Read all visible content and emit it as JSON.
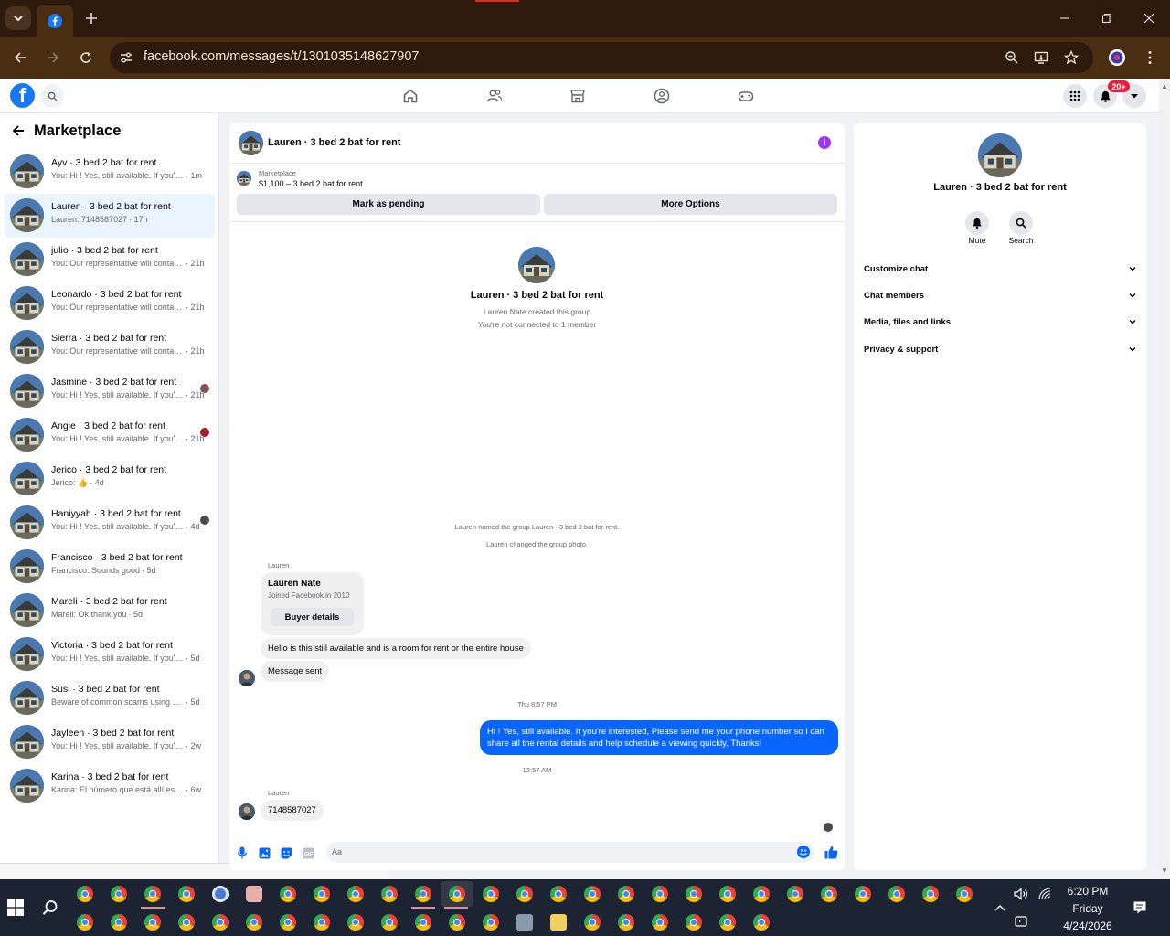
{
  "browser": {
    "url": "facebook.com/messages/t/1301035148627907"
  },
  "fb_nav": {
    "logo": "f",
    "notification_badge": "20+"
  },
  "left": {
    "title": "Marketplace",
    "conversations": [
      {
        "name": "Ayv · 3 bed 2 bat for rent",
        "preview": "You: Hi ! Yes, still available. If you're in...",
        "time": "· 1m"
      },
      {
        "name": "Lauren · 3 bed 2 bat for rent",
        "preview": "Lauren: 7148587027",
        "time": "· 17h"
      },
      {
        "name": "julio · 3 bed 2 bat for rent",
        "preview": "You: Our representative will contact ...",
        "time": "· 21h"
      },
      {
        "name": "Leonardo · 3 bed 2 bat for rent",
        "preview": "You: Our representative will contact ...",
        "time": "· 21h"
      },
      {
        "name": "Sierra · 3 bed 2 bat for rent",
        "preview": "You: Our representative will contact ...",
        "time": "· 21h"
      },
      {
        "name": "Jasmine · 3 bed 2 bat for rent",
        "preview": "You: Hi ! Yes, still available. If you'r...",
        "time": "· 21h"
      },
      {
        "name": "Angie · 3 bed 2 bat for rent",
        "preview": "You: Hi ! Yes, still available. If you'r...",
        "time": "· 21h"
      },
      {
        "name": "Jerico · 3 bed 2 bat for rent",
        "preview": "Jerico: 👍",
        "time": "· 4d"
      },
      {
        "name": "Haniyyah · 3 bed 2 bat for rent",
        "preview": "You: Hi ! Yes, still available. If you're...",
        "time": "· 4d"
      },
      {
        "name": "Francisco · 3 bed 2 bat for rent",
        "preview": "Francisco: Sounds good",
        "time": "· 5d"
      },
      {
        "name": "Mareli · 3 bed 2 bat for rent",
        "preview": "Mareli: Ok thank you",
        "time": "· 5d"
      },
      {
        "name": "Victoria · 3 bed 2 bat for rent",
        "preview": "You: Hi ! Yes, still available. If you're in...",
        "time": "· 5d"
      },
      {
        "name": "Susi · 3 bed 2 bat for rent",
        "preview": "Beware of common scams using pay...",
        "time": "· 5d"
      },
      {
        "name": "Jayleen · 3 bed 2 bat for rent",
        "preview": "You: Hi ! Yes, still available. If you're in...",
        "time": "· 2w"
      },
      {
        "name": "Karina · 3 bed 2 bat for rent",
        "preview": "Karina: El número que está allí esa es ...",
        "time": "· 6w"
      }
    ]
  },
  "chat": {
    "title": "Lauren · 3 bed 2 bat for rent",
    "marketplace_label": "Marketplace",
    "listing": "$1,100 – 3 bed 2 bat for rent",
    "btn_pending": "Mark as pending",
    "btn_options": "More Options",
    "group_name": "Lauren · 3 bed 2 bat for rent",
    "group_created": "Lauren Nate created this group",
    "group_connected": "You're not connected to 1 member",
    "sys_named": "Lauren named the group Lauren · 3 bed 2 bat for rent.",
    "sys_photo": "Lauren changed the group photo.",
    "sender1": "Lauren",
    "card_name": "Lauren Nate",
    "card_sub": "Joined Facebook in 2010",
    "card_btn": "Buyer details",
    "msg1": "Hello is this still available and is a room for rent or the entire house",
    "msg2": "Message sent",
    "time1": "Thu 8:57 PM",
    "reply": "Hi ! Yes, still available. If you're interested, Please send me your phone number so I can share all the rental details and help schedule a viewing quickly, Thanks!",
    "time2": "12:57 AM",
    "sender2": "Lauren",
    "msg3": "7148587027",
    "composer_placeholder": "Aa"
  },
  "right": {
    "name": "Lauren · 3 bed 2 bat for rent",
    "mute_label": "Mute",
    "search_label": "Search",
    "rows": [
      "Customize chat",
      "Chat members",
      "Media, files and links",
      "Privacy & support"
    ]
  },
  "taskbar": {
    "time": "6:20 PM",
    "day": "Friday",
    "date": "4/24/2026"
  }
}
